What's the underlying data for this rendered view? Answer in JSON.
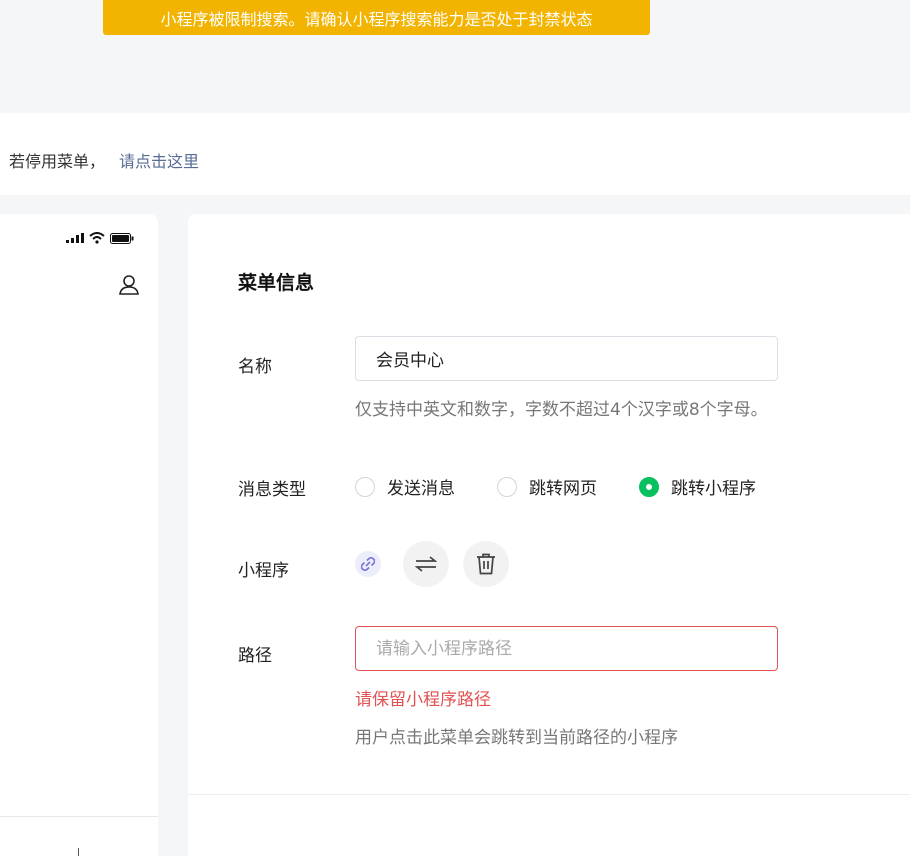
{
  "banner": {
    "text": "小程序被限制搜索。请确认小程序搜索能力是否处于封禁状态"
  },
  "notice": {
    "prefix": "若停用菜单，",
    "link": "请点击这里"
  },
  "form": {
    "title": "菜单信息",
    "name": {
      "label": "名称",
      "value": "会员中心",
      "hint": "仅支持中英文和数字，字数不超过4个汉字或8个字母。"
    },
    "msg_type": {
      "label": "消息类型",
      "options": [
        "发送消息",
        "跳转网页",
        "跳转小程序"
      ],
      "selected": "跳转小程序"
    },
    "miniprogram": {
      "label": "小程序"
    },
    "path": {
      "label": "路径",
      "placeholder": "请输入小程序路径",
      "error": "请保留小程序路径",
      "hint": "用户点击此菜单会跳转到当前路径的小程序"
    }
  },
  "colors": {
    "warning": "#f2b400",
    "accent": "#07c160",
    "link": "#576b95",
    "error": "#e15252"
  },
  "icons": [
    "signal-icon",
    "wifi-icon",
    "battery-icon",
    "profile-icon",
    "link-icon",
    "swap-icon",
    "trash-icon"
  ]
}
